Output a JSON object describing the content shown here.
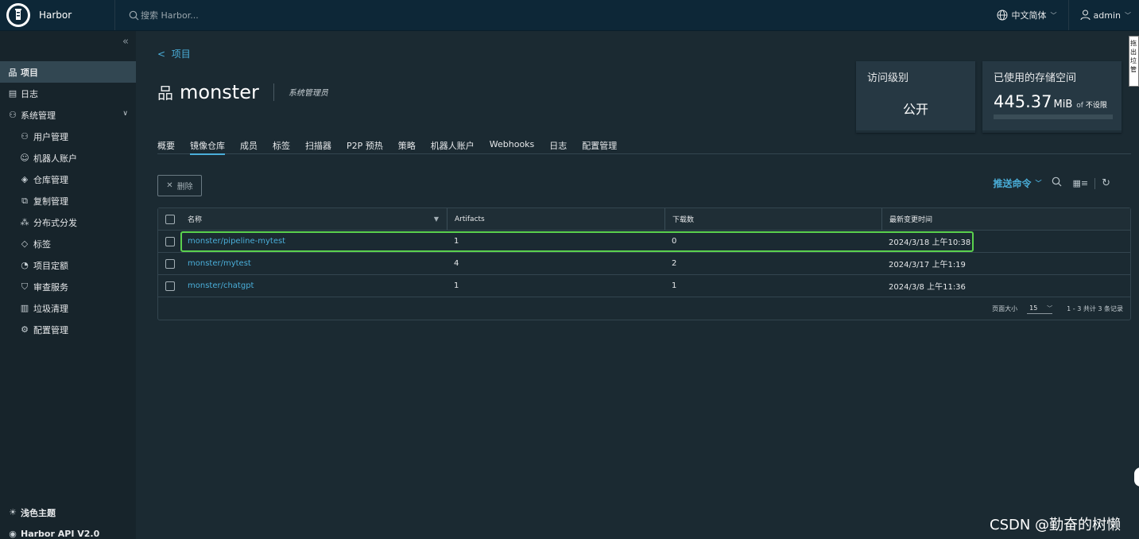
{
  "header": {
    "brand": "Harbor",
    "search_placeholder": "搜索 Harbor...",
    "language": "中文简体",
    "user": "admin"
  },
  "sidebar": {
    "items": [
      {
        "label": "项目",
        "icon": "project-icon",
        "active": true
      },
      {
        "label": "日志",
        "icon": "log-icon"
      },
      {
        "label": "系统管理",
        "icon": "admin-icon",
        "expanded": true
      }
    ],
    "sub_items": [
      {
        "label": "用户管理",
        "icon": "users-icon"
      },
      {
        "label": "机器人账户",
        "icon": "robot-icon"
      },
      {
        "label": "仓库管理",
        "icon": "registry-icon"
      },
      {
        "label": "复制管理",
        "icon": "replication-icon"
      },
      {
        "label": "分布式分发",
        "icon": "distribution-icon"
      },
      {
        "label": "标签",
        "icon": "tag-icon"
      },
      {
        "label": "项目定额",
        "icon": "quota-icon"
      },
      {
        "label": "审查服务",
        "icon": "shield-icon"
      },
      {
        "label": "垃圾清理",
        "icon": "trash-icon"
      },
      {
        "label": "配置管理",
        "icon": "gear-icon"
      }
    ],
    "bottom": [
      {
        "label": "浅色主题",
        "icon": "sun-icon"
      },
      {
        "label": "Harbor API V2.0",
        "icon": "api-icon"
      }
    ]
  },
  "main": {
    "back_label": "项目",
    "project_name": "monster",
    "project_role": "系统管理员",
    "access_card": {
      "title": "访问级别",
      "value": "公开"
    },
    "storage_card": {
      "title": "已使用的存储空间",
      "value": "445.37",
      "unit": "MiB",
      "of": "of",
      "limit": "不设限"
    },
    "tabs": [
      "概要",
      "镜像仓库",
      "成员",
      "标签",
      "扫描器",
      "P2P 预热",
      "策略",
      "机器人账户",
      "Webhooks",
      "日志",
      "配置管理"
    ],
    "active_tab": "镜像仓库",
    "delete_label": "删除",
    "push_command_label": "推送命令",
    "table": {
      "headers": [
        "名称",
        "Artifacts",
        "下载数",
        "最新变更时间"
      ],
      "rows": [
        {
          "name": "monster/pipeline-mytest",
          "artifacts": "1",
          "downloads": "0",
          "updated": "2024/3/18 上午10:38"
        },
        {
          "name": "monster/mytest",
          "artifacts": "4",
          "downloads": "2",
          "updated": "2024/3/17 上午1:19"
        },
        {
          "name": "monster/chatgpt",
          "artifacts": "1",
          "downloads": "1",
          "updated": "2024/3/8 上午11:36"
        }
      ],
      "page_size_label": "页面大小",
      "page_size": "15",
      "pagination_summary": "1 - 3 共计 3 条记录"
    }
  },
  "watermark": "CSDN @勤奋的树懒",
  "edge_text": "拖出垃管",
  "colors": {
    "accent": "#4aaed9",
    "highlight": "#5ad14e",
    "header_bg": "#0d2737",
    "sidebar_bg": "#17242b"
  }
}
